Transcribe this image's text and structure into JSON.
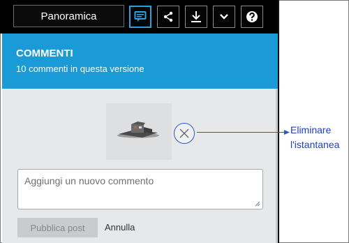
{
  "toolbar": {
    "view_label": "Panoramica",
    "buttons": [
      {
        "icon": "comment-icon",
        "active": true
      },
      {
        "icon": "share-icon",
        "active": false
      },
      {
        "icon": "download-icon",
        "active": false
      },
      {
        "icon": "chevron-down-icon",
        "active": false
      },
      {
        "icon": "help-icon",
        "active": false
      }
    ]
  },
  "panel": {
    "title": "COMMENTI",
    "subtitle": "10 commenti in questa versione",
    "comment_placeholder": "Aggiungi un nuovo commento",
    "post_label": "Pubblica post",
    "cancel_label": "Annulla"
  },
  "callout": {
    "line1": "Eliminare",
    "line2": "l'istantanea"
  },
  "colors": {
    "accent": "#1a9ad6",
    "callout": "#3553c9",
    "toolbar_bg": "#000000",
    "panel_bg": "#e6e8ea"
  }
}
